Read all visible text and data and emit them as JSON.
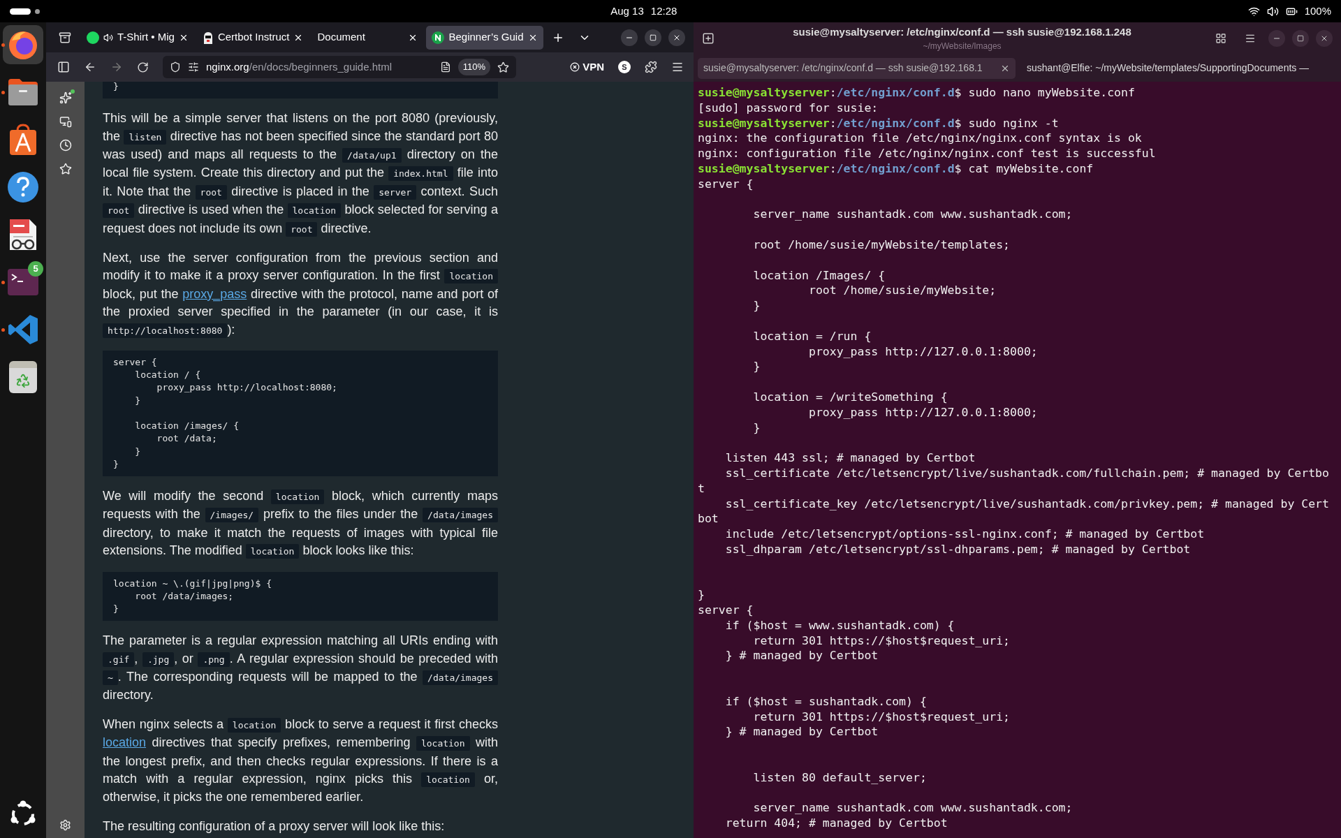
{
  "top_bar": {
    "date": "Aug 13",
    "time": "12:28",
    "battery": "100%"
  },
  "dock": {
    "items": [
      {
        "kind": "firefox",
        "running": true,
        "selected": true
      },
      {
        "kind": "files",
        "running": true,
        "selected": false
      },
      {
        "kind": "appcenter",
        "running": false,
        "selected": false
      },
      {
        "kind": "help",
        "running": false,
        "selected": false
      },
      {
        "kind": "docviewer",
        "running": false,
        "selected": false
      },
      {
        "kind": "terminal",
        "running": true,
        "selected": false,
        "badge": "5"
      },
      {
        "kind": "vscode",
        "running": true,
        "selected": false
      },
      {
        "kind": "trash",
        "running": false,
        "selected": false
      }
    ]
  },
  "browser": {
    "tabs": [
      {
        "kind": "spotify",
        "label": "T-Shirt • Mig",
        "audio": true,
        "selected": false
      },
      {
        "kind": "certbot",
        "label": "Certbot Instruct",
        "audio": false,
        "selected": false
      },
      {
        "kind": "plain",
        "label": "Document",
        "audio": false,
        "selected": false
      },
      {
        "kind": "nginx",
        "label": "Beginner’s Guid",
        "audio": false,
        "selected": true
      }
    ],
    "url": {
      "host": "nginx.org",
      "path": "/en/docs/beginners_guide.html"
    },
    "zoom": "110%",
    "vpn": "VPN",
    "profile": "S",
    "content": [
      {
        "kind": "code",
        "text": "}"
      },
      {
        "kind": "paragraph",
        "segments": [
          {
            "kind": "text",
            "text": "This will be a simple server that listens on the port 8080 (previously, the "
          },
          {
            "kind": "code",
            "text": "listen"
          },
          {
            "kind": "text",
            "text": " directive has not been specified since the standard port 80 was used) and maps all requests to the "
          },
          {
            "kind": "code",
            "text": "/data/up1"
          },
          {
            "kind": "text",
            "text": " directory on the local file system. Create this directory and put the "
          },
          {
            "kind": "code",
            "text": "index.html"
          },
          {
            "kind": "text",
            "text": " file into it. Note that the "
          },
          {
            "kind": "code",
            "text": "root"
          },
          {
            "kind": "text",
            "text": " directive is placed in the "
          },
          {
            "kind": "code",
            "text": "server"
          },
          {
            "kind": "text",
            "text": " context. Such "
          },
          {
            "kind": "code",
            "text": "root"
          },
          {
            "kind": "text",
            "text": " directive is used when the "
          },
          {
            "kind": "code",
            "text": "location"
          },
          {
            "kind": "text",
            "text": " block selected for serving a request does not include its own "
          },
          {
            "kind": "code",
            "text": "root"
          },
          {
            "kind": "text",
            "text": " directive."
          }
        ]
      },
      {
        "kind": "paragraph",
        "segments": [
          {
            "kind": "text",
            "text": "Next, use the server configuration from the previous section and modify it to make it a proxy server configuration. In the first "
          },
          {
            "kind": "code",
            "text": "location"
          },
          {
            "kind": "text",
            "text": " block, put the "
          },
          {
            "kind": "link",
            "text": "proxy_pass"
          },
          {
            "kind": "text",
            "text": " directive with the protocol, name and port of the proxied server specified in the parameter (in our case, it is "
          },
          {
            "kind": "code",
            "text": "http://localhost:8080"
          },
          {
            "kind": "text",
            "text": "):"
          }
        ]
      },
      {
        "kind": "code",
        "text": "server {\n    location / {\n        proxy_pass http://localhost:8080;\n    }\n\n    location /images/ {\n        root /data;\n    }\n}"
      },
      {
        "kind": "paragraph",
        "segments": [
          {
            "kind": "text",
            "text": "We will modify the second "
          },
          {
            "kind": "code",
            "text": "location"
          },
          {
            "kind": "text",
            "text": " block, which currently maps requests with the "
          },
          {
            "kind": "code",
            "text": "/images/"
          },
          {
            "kind": "text",
            "text": " prefix to the files under the "
          },
          {
            "kind": "code",
            "text": "/data/images"
          },
          {
            "kind": "text",
            "text": " directory, to make it match the requests of images with typical file extensions. The modified "
          },
          {
            "kind": "code",
            "text": "location"
          },
          {
            "kind": "text",
            "text": " block looks like this:"
          }
        ]
      },
      {
        "kind": "code",
        "text": "location ~ \\.(gif|jpg|png)$ {\n    root /data/images;\n}"
      },
      {
        "kind": "paragraph",
        "segments": [
          {
            "kind": "text",
            "text": "The parameter is a regular expression matching all URIs ending with "
          },
          {
            "kind": "code",
            "text": ".gif"
          },
          {
            "kind": "text",
            "text": ", "
          },
          {
            "kind": "code",
            "text": ".jpg"
          },
          {
            "kind": "text",
            "text": ", or "
          },
          {
            "kind": "code",
            "text": ".png"
          },
          {
            "kind": "text",
            "text": ". A regular expression should be preceded with "
          },
          {
            "kind": "code",
            "text": "~"
          },
          {
            "kind": "text",
            "text": ". The corresponding requests will be mapped to the "
          },
          {
            "kind": "code",
            "text": "/data/images"
          },
          {
            "kind": "text",
            "text": " directory."
          }
        ]
      },
      {
        "kind": "paragraph",
        "segments": [
          {
            "kind": "text",
            "text": "When nginx selects a "
          },
          {
            "kind": "code",
            "text": "location"
          },
          {
            "kind": "text",
            "text": " block to serve a request it first checks "
          },
          {
            "kind": "link",
            "text": "location"
          },
          {
            "kind": "text",
            "text": " directives that specify prefixes, remembering "
          },
          {
            "kind": "code",
            "text": "location"
          },
          {
            "kind": "text",
            "text": " with the longest prefix, and then checks regular expressions. If there is a match with a regular expression, nginx picks this "
          },
          {
            "kind": "code",
            "text": "location"
          },
          {
            "kind": "text",
            "text": " or, otherwise, it picks the one remembered earlier."
          }
        ]
      },
      {
        "kind": "paragraph",
        "segments": [
          {
            "kind": "text",
            "text": "The resulting configuration of a proxy server will look like this:"
          }
        ]
      }
    ]
  },
  "terminal": {
    "title": "susie@mysaltyserver: /etc/nginx/conf.d — ssh susie@192.168.1.248",
    "subtitle": "~/myWebsite/Images",
    "tabs": [
      {
        "label": "susie@mysaltyserver: /etc/nginx/conf.d — ssh susie@192.168.1",
        "selected": true
      },
      {
        "label": "sushant@Elfie: ~/myWebsite/templates/SupportingDocuments —",
        "selected": false
      }
    ],
    "lines": [
      {
        "kind": "prompt",
        "user": "susie@mysaltyserver",
        "separator": ":",
        "path": "/etc/nginx/conf.d",
        "end": "$",
        "command": "sudo nano myWebsite.conf"
      },
      {
        "kind": "output",
        "text": "[sudo] password for susie:"
      },
      {
        "kind": "prompt",
        "user": "susie@mysaltyserver",
        "separator": ":",
        "path": "/etc/nginx/conf.d",
        "end": "$",
        "command": "sudo nginx -t"
      },
      {
        "kind": "output",
        "text": "nginx: the configuration file /etc/nginx/nginx.conf syntax is ok"
      },
      {
        "kind": "output",
        "text": "nginx: configuration file /etc/nginx/nginx.conf test is successful"
      },
      {
        "kind": "prompt",
        "user": "susie@mysaltyserver",
        "separator": ":",
        "path": "/etc/nginx/conf.d",
        "end": "$",
        "command": "cat myWebsite.conf"
      },
      {
        "kind": "output",
        "text": "server {"
      },
      {
        "kind": "blank"
      },
      {
        "kind": "output",
        "text": "        server_name sushantadk.com www.sushantadk.com;"
      },
      {
        "kind": "blank"
      },
      {
        "kind": "output",
        "text": "        root /home/susie/myWebsite/templates;"
      },
      {
        "kind": "blank"
      },
      {
        "kind": "output",
        "text": "        location /Images/ {"
      },
      {
        "kind": "output",
        "text": "                root /home/susie/myWebsite;"
      },
      {
        "kind": "output",
        "text": "        }"
      },
      {
        "kind": "blank"
      },
      {
        "kind": "output",
        "text": "        location = /run {"
      },
      {
        "kind": "output",
        "text": "                proxy_pass http://127.0.0.1:8000;"
      },
      {
        "kind": "output",
        "text": "        }"
      },
      {
        "kind": "blank"
      },
      {
        "kind": "output",
        "text": "        location = /writeSomething {"
      },
      {
        "kind": "output",
        "text": "                proxy_pass http://127.0.0.1:8000;"
      },
      {
        "kind": "output",
        "text": "        }"
      },
      {
        "kind": "blank"
      },
      {
        "kind": "output",
        "text": "    listen 443 ssl; # managed by Certbot"
      },
      {
        "kind": "output",
        "text": "    ssl_certificate /etc/letsencrypt/live/sushantadk.com/fullchain.pem; # managed by Certbo"
      },
      {
        "kind": "output",
        "text": "t"
      },
      {
        "kind": "output",
        "text": "    ssl_certificate_key /etc/letsencrypt/live/sushantadk.com/privkey.pem; # managed by Cert"
      },
      {
        "kind": "output",
        "text": "bot"
      },
      {
        "kind": "output",
        "text": "    include /etc/letsencrypt/options-ssl-nginx.conf; # managed by Certbot"
      },
      {
        "kind": "output",
        "text": "    ssl_dhparam /etc/letsencrypt/ssl-dhparams.pem; # managed by Certbot"
      },
      {
        "kind": "blank"
      },
      {
        "kind": "blank"
      },
      {
        "kind": "output",
        "text": "}"
      },
      {
        "kind": "output",
        "text": "server {"
      },
      {
        "kind": "output",
        "text": "    if ($host = www.sushantadk.com) {"
      },
      {
        "kind": "output",
        "text": "        return 301 https://$host$request_uri;"
      },
      {
        "kind": "output",
        "text": "    } # managed by Certbot"
      },
      {
        "kind": "blank"
      },
      {
        "kind": "blank"
      },
      {
        "kind": "output",
        "text": "    if ($host = sushantadk.com) {"
      },
      {
        "kind": "output",
        "text": "        return 301 https://$host$request_uri;"
      },
      {
        "kind": "output",
        "text": "    } # managed by Certbot"
      },
      {
        "kind": "blank"
      },
      {
        "kind": "blank"
      },
      {
        "kind": "output",
        "text": "        listen 80 default_server;"
      },
      {
        "kind": "blank"
      },
      {
        "kind": "output",
        "text": "        server_name sushantadk.com www.sushantadk.com;"
      },
      {
        "kind": "output",
        "text": "    return 404; # managed by Certbot"
      }
    ]
  }
}
